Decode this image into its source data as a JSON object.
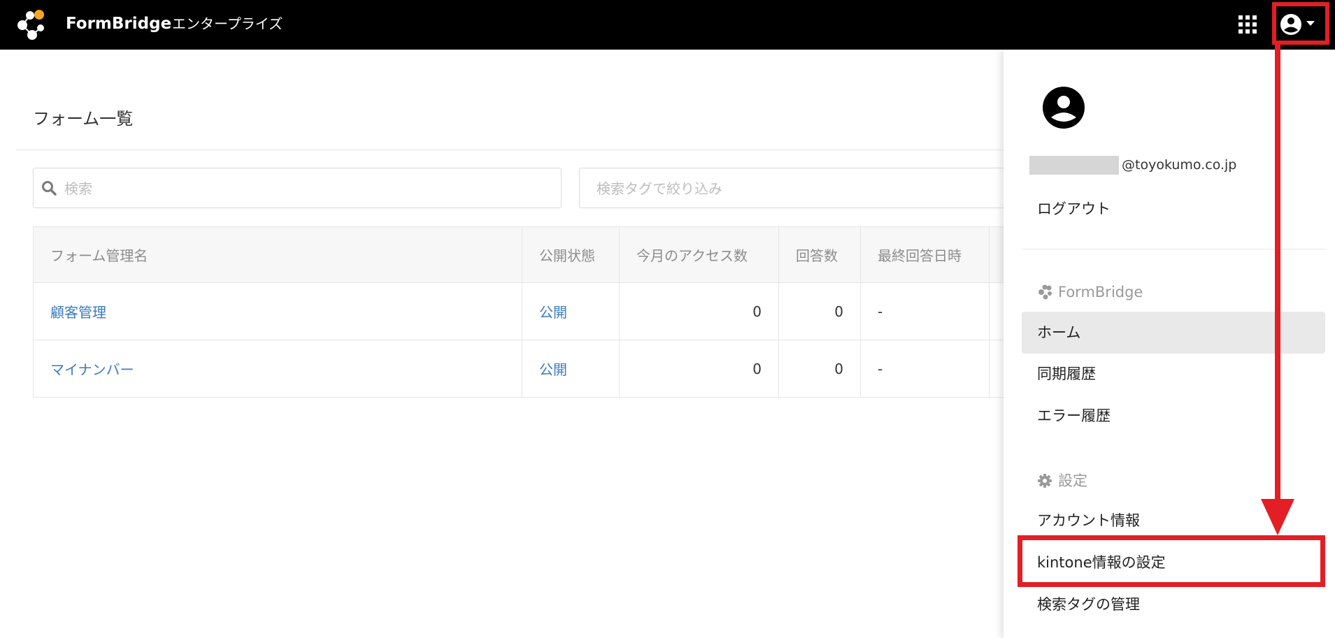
{
  "header": {
    "brand": "FormBridge",
    "edition": "エンタープライズ",
    "apps_icon": "grid-apps-icon",
    "user_icon": "account-circle-icon"
  },
  "main": {
    "title": "フォーム一覧",
    "search": {
      "placeholder": "検索"
    },
    "tag_filter": {
      "placeholder": "検索タグで絞り込み"
    },
    "table": {
      "columns": [
        "フォーム管理名",
        "公開状態",
        "今月のアクセス数",
        "回答数",
        "最終回答日時"
      ],
      "rows": [
        {
          "name": "顧客管理",
          "status": "公開",
          "access": "0",
          "answers": "0",
          "last": "-"
        },
        {
          "name": "マイナンバー",
          "status": "公開",
          "access": "0",
          "answers": "0",
          "last": "-"
        }
      ]
    }
  },
  "dropdown": {
    "email_domain": "@toyokumo.co.jp",
    "logout": "ログアウト",
    "formbridge_section": "FormBridge",
    "items": [
      "ホーム",
      "同期履歴",
      "エラー履歴"
    ],
    "settings_section": "設定",
    "settings_items": [
      "アカウント情報",
      "kintone情報の設定",
      "検索タグの管理"
    ]
  },
  "colors": {
    "header_bg": "#000000",
    "link": "#3a7bc0",
    "annotation": "#e31e24",
    "logo_accent": "#f5a623"
  }
}
